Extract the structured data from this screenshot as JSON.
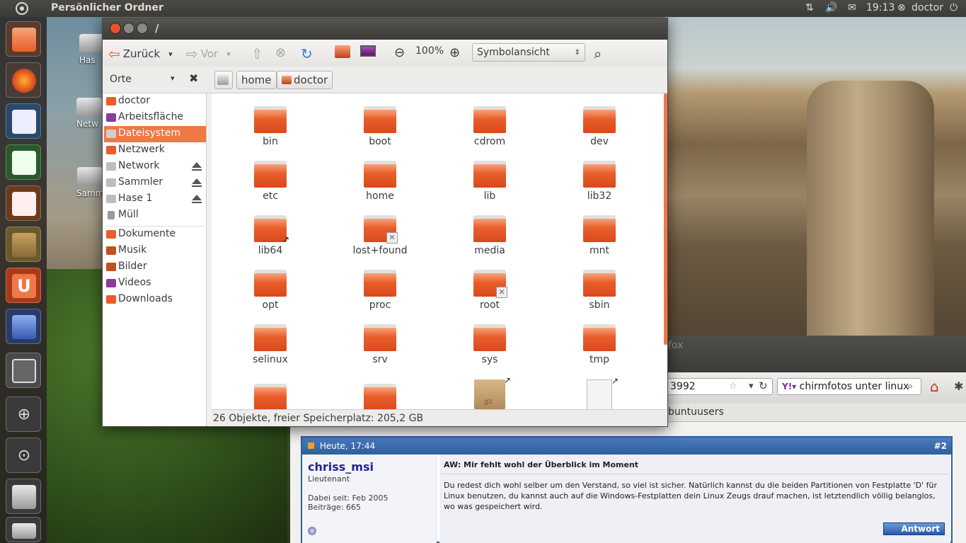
{
  "top_panel": {
    "title": "Persönlicher Ordner",
    "time": "19:13",
    "user": "doctor"
  },
  "desktop_icons": [
    {
      "label": "Has"
    },
    {
      "label": "Netw"
    },
    {
      "label": "Samm"
    }
  ],
  "window": {
    "title": "/"
  },
  "toolbar": {
    "back_label": "Zurück",
    "forward_label": "Vor",
    "zoom_level": "100%",
    "view_mode": "Symbolansicht"
  },
  "sidebar": {
    "header": "Orte",
    "places": [
      {
        "label": "doctor",
        "color": "#e95d2a"
      },
      {
        "label": "Arbeitsfläche",
        "color": "#8a3aa0"
      },
      {
        "label": "Dateisystem",
        "color": "#cfcfcf"
      },
      {
        "label": "Netzwerk",
        "color": "#e95d2a"
      },
      {
        "label": "Network",
        "color": "#bdbdbd"
      },
      {
        "label": "Sammler",
        "color": "#bdbdbd"
      },
      {
        "label": "Hase 1",
        "color": "#bdbdbd"
      },
      {
        "label": "Müll",
        "color": "#9a9a9a"
      }
    ],
    "bookmarks": [
      {
        "label": "Dokumente",
        "color": "#e95d2a"
      },
      {
        "label": "Musik",
        "color": "#c0501e"
      },
      {
        "label": "Bilder",
        "color": "#c0501e"
      },
      {
        "label": "Videos",
        "color": "#8a3aa0"
      },
      {
        "label": "Downloads",
        "color": "#e95d2a"
      }
    ]
  },
  "pathbar": {
    "crumbs": [
      "home",
      "doctor"
    ]
  },
  "files": [
    {
      "name": "bin"
    },
    {
      "name": "boot"
    },
    {
      "name": "cdrom"
    },
    {
      "name": "dev"
    },
    {
      "name": "etc"
    },
    {
      "name": "home"
    },
    {
      "name": "lib"
    },
    {
      "name": "lib32"
    },
    {
      "name": "lib64"
    },
    {
      "name": "lost+found"
    },
    {
      "name": "media"
    },
    {
      "name": "mnt"
    },
    {
      "name": "opt"
    },
    {
      "name": "proc"
    },
    {
      "name": "root"
    },
    {
      "name": "sbin"
    },
    {
      "name": "selinux"
    },
    {
      "name": "srv"
    },
    {
      "name": "sys"
    },
    {
      "name": "tmp"
    }
  ],
  "archive_label": "gz",
  "status": {
    "text": "26 Objekte, freier Speicherplatz: 205,2 GB"
  },
  "browser": {
    "title_partial": "fox",
    "url_partial": "3992",
    "search_value": "chirmfotos unter linux",
    "bookmark_partial": "buntuusers",
    "post": {
      "date": "Heute, 17:44",
      "number": "#2",
      "author": "chriss_msi",
      "rank": "Lieutenant",
      "joined": "Dabei seit: Feb 2005",
      "posts": "Beiträge: 665",
      "subject": "AW: Mir fehlt wohl der Überblick im Moment",
      "body": "Du redest dich wohl selber um den Verstand, so viel ist sicher. Natürlich kannst du die beiden Partitionen von Festplatte 'D' für Linux benutzen, du kannst auch auf die Windows-Festplatten dein Linux Zeugs drauf machen, ist letztendlich völlig belanglos, wo was gespeichert wird.",
      "reply_label": "Antwort"
    }
  },
  "colors": {
    "accent": "#f07746",
    "folder": "#e95d2a",
    "panel": "#3c3b37"
  }
}
